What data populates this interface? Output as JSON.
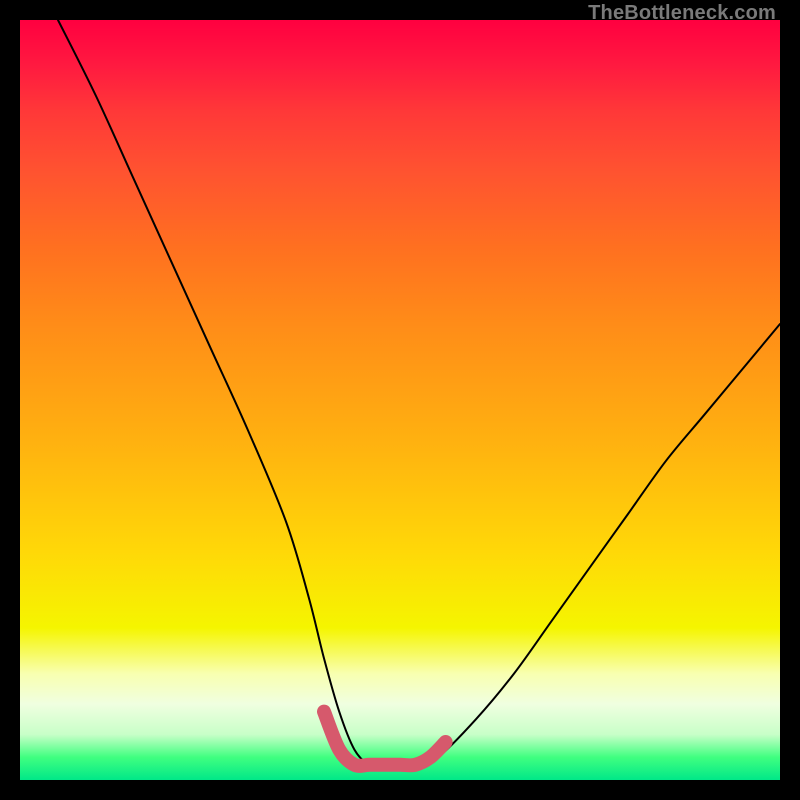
{
  "watermark": "TheBottleneck.com",
  "chart_data": {
    "type": "line",
    "title": "",
    "xlabel": "",
    "ylabel": "",
    "xlim": [
      0,
      100
    ],
    "ylim": [
      0,
      100
    ],
    "grid": false,
    "legend": false,
    "series": [
      {
        "name": "bottleneck-curve",
        "x": [
          5,
          10,
          15,
          20,
          25,
          30,
          35,
          38,
          40,
          42,
          44,
          46,
          48,
          50,
          52,
          55,
          60,
          65,
          70,
          75,
          80,
          85,
          90,
          95,
          100
        ],
        "values": [
          100,
          90,
          79,
          68,
          57,
          46,
          34,
          24,
          16,
          9,
          4,
          2,
          2,
          2,
          2,
          3,
          8,
          14,
          21,
          28,
          35,
          42,
          48,
          54,
          60
        ]
      }
    ],
    "highlight_segment": {
      "name": "flat-minimum",
      "color": "#d6596c",
      "x": [
        40,
        42,
        44,
        46,
        48,
        50,
        52,
        54,
        56
      ],
      "values": [
        9,
        4,
        2,
        2,
        2,
        2,
        2,
        3,
        5
      ]
    },
    "background_gradient": {
      "direction": "top-to-bottom",
      "stops": [
        {
          "pos": 0,
          "color": "#ff0040"
        },
        {
          "pos": 40,
          "color": "#ff8c18"
        },
        {
          "pos": 80,
          "color": "#f5f500"
        },
        {
          "pos": 100,
          "color": "#00e888"
        }
      ]
    }
  }
}
